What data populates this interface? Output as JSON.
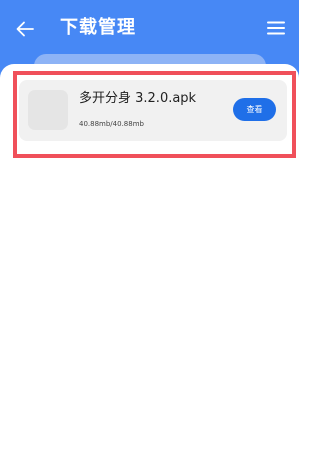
{
  "header": {
    "title": "下载管理",
    "back_icon": "arrow-left-icon",
    "menu_icon": "hamburger-menu-icon",
    "background_color": "#4788f5"
  },
  "downloads": [
    {
      "name": "多开分身 3.2.0.apk",
      "size": "40.88mb/40.88mb",
      "action_label": "查看"
    }
  ],
  "colors": {
    "accent": "#1f6fe8",
    "highlight_border": "#f0505a",
    "card_background": "#f1f1f1"
  }
}
